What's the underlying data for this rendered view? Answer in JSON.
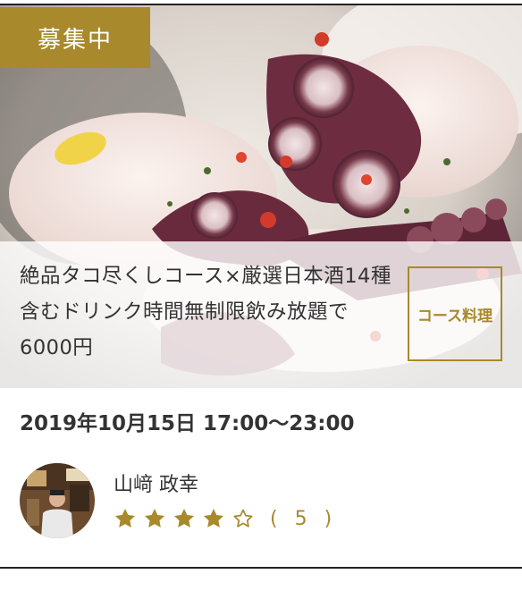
{
  "event": {
    "status_badge": "募集中",
    "title": "絶品タコ尽くしコース×厳選日本酒14種含むドリンク時間無制限飲み放題で6000円",
    "course_tag": "コース料理",
    "datetime": "2019年10月15日 17:00〜23:00"
  },
  "host": {
    "name": "山﨑 政幸",
    "rating": 4,
    "rating_max": 5,
    "review_count_label": "( 5 )"
  },
  "colors": {
    "accent_gold": "#a8892b",
    "text": "#333333"
  },
  "icons": {
    "filled_star": "star-filled-icon",
    "empty_star": "star-outline-icon"
  }
}
